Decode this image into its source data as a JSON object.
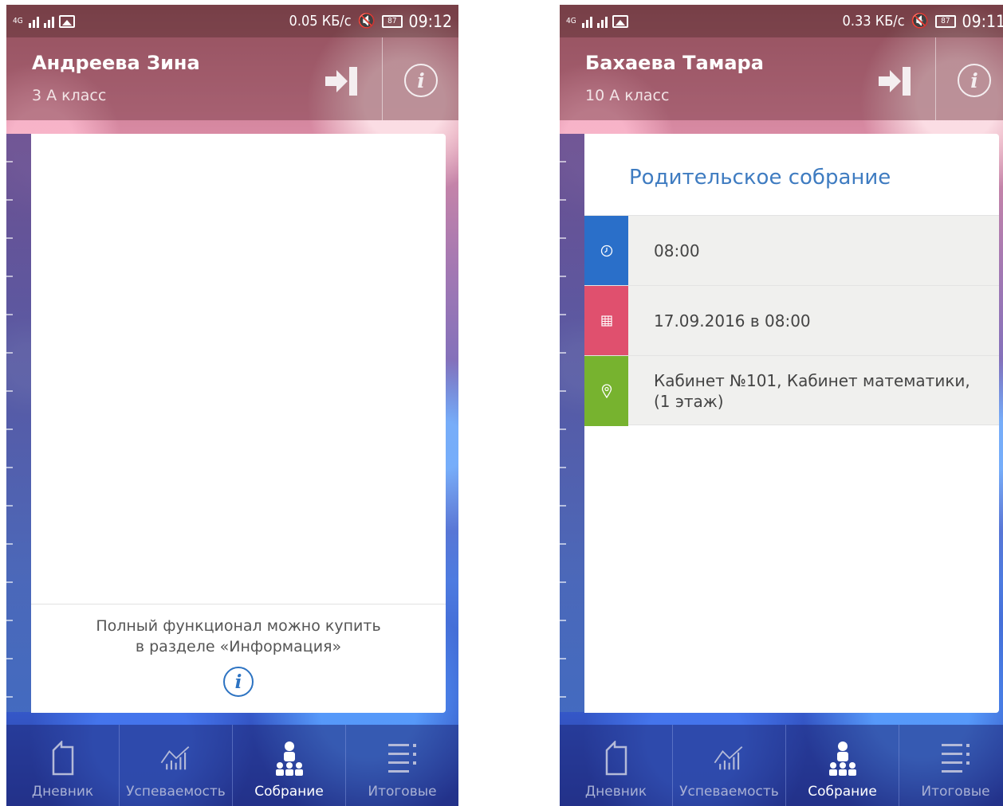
{
  "screens": [
    {
      "status_bar": {
        "network": "4G",
        "speed": "0.05 КБ/с",
        "battery": "87",
        "time": "09:12"
      },
      "header": {
        "student_name": "Андреева Зина",
        "student_class": "3 А класс"
      },
      "promo": {
        "line1": "Полный функционал можно купить",
        "line2": "в разделе «Информация»"
      },
      "nav": [
        "Дневник",
        "Успеваемость",
        "Собрание",
        "Итоговые"
      ],
      "active_tab": "Собрание"
    },
    {
      "status_bar": {
        "network": "4G",
        "speed": "0.33 КБ/с",
        "battery": "87",
        "time": "09:11"
      },
      "header": {
        "student_name": "Бахаева Тамара",
        "student_class": "10 А класс"
      },
      "meeting": {
        "title": "Родительское собрание",
        "time": "08:00",
        "date": "17.09.2016 в 08:00",
        "location": "Кабинет №101, Кабинет математики, (1 этаж)"
      },
      "nav": [
        "Дневник",
        "Успеваемость",
        "Собрание",
        "Итоговые"
      ],
      "active_tab": "Собрание"
    }
  ],
  "icons": [
    "signal-icon",
    "image-icon",
    "mute-icon",
    "battery-icon",
    "logout-icon",
    "info-icon",
    "clock-icon",
    "calendar-icon",
    "location-pin-icon",
    "diary-icon",
    "chart-icon",
    "meeting-icon",
    "list-icon"
  ],
  "colors": {
    "accent_blue": "#2a6fc9",
    "accent_red": "#e0506e",
    "accent_green": "#77b32f",
    "title_blue": "#3f7cc1"
  }
}
